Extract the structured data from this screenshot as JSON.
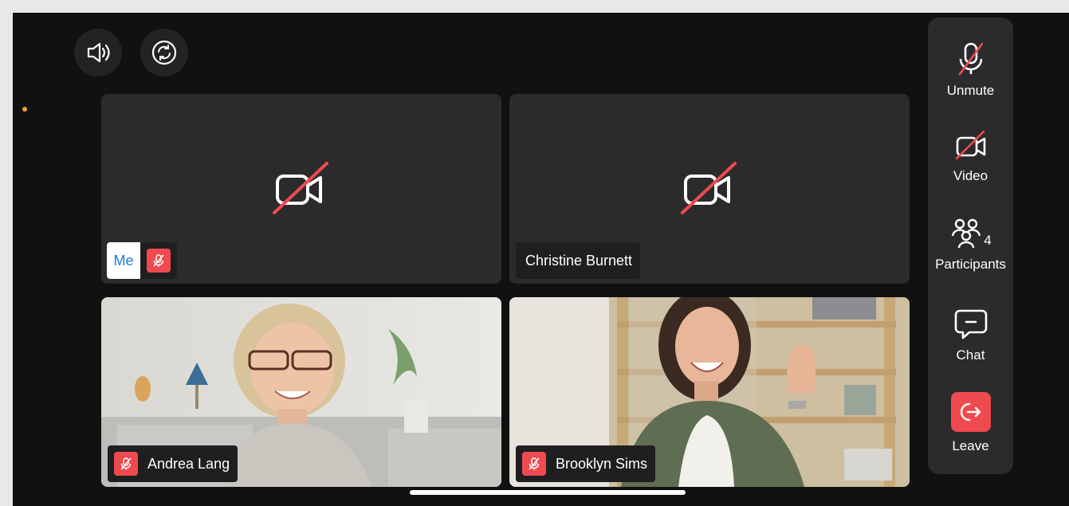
{
  "tiles": [
    {
      "name": "Me",
      "video": false,
      "muted": true
    },
    {
      "name": "Christine Burnett",
      "video": false,
      "muted": false
    },
    {
      "name": "Andrea Lang",
      "video": true,
      "muted": true
    },
    {
      "name": "Brooklyn Sims",
      "video": true,
      "muted": true
    }
  ],
  "sidebar": {
    "unmute_label": "Unmute",
    "video_label": "Video",
    "participants_label": "Participants",
    "participants_count": "4",
    "chat_label": "Chat",
    "leave_label": "Leave"
  },
  "colors": {
    "background": "#111112",
    "tile": "#2b2b2d",
    "danger": "#ef4a4f",
    "me_text": "#1f79d8",
    "status_dot": "#f0a323"
  },
  "icons": {
    "top_left": "speaker-icon",
    "top_right": "camera-switch-icon"
  }
}
